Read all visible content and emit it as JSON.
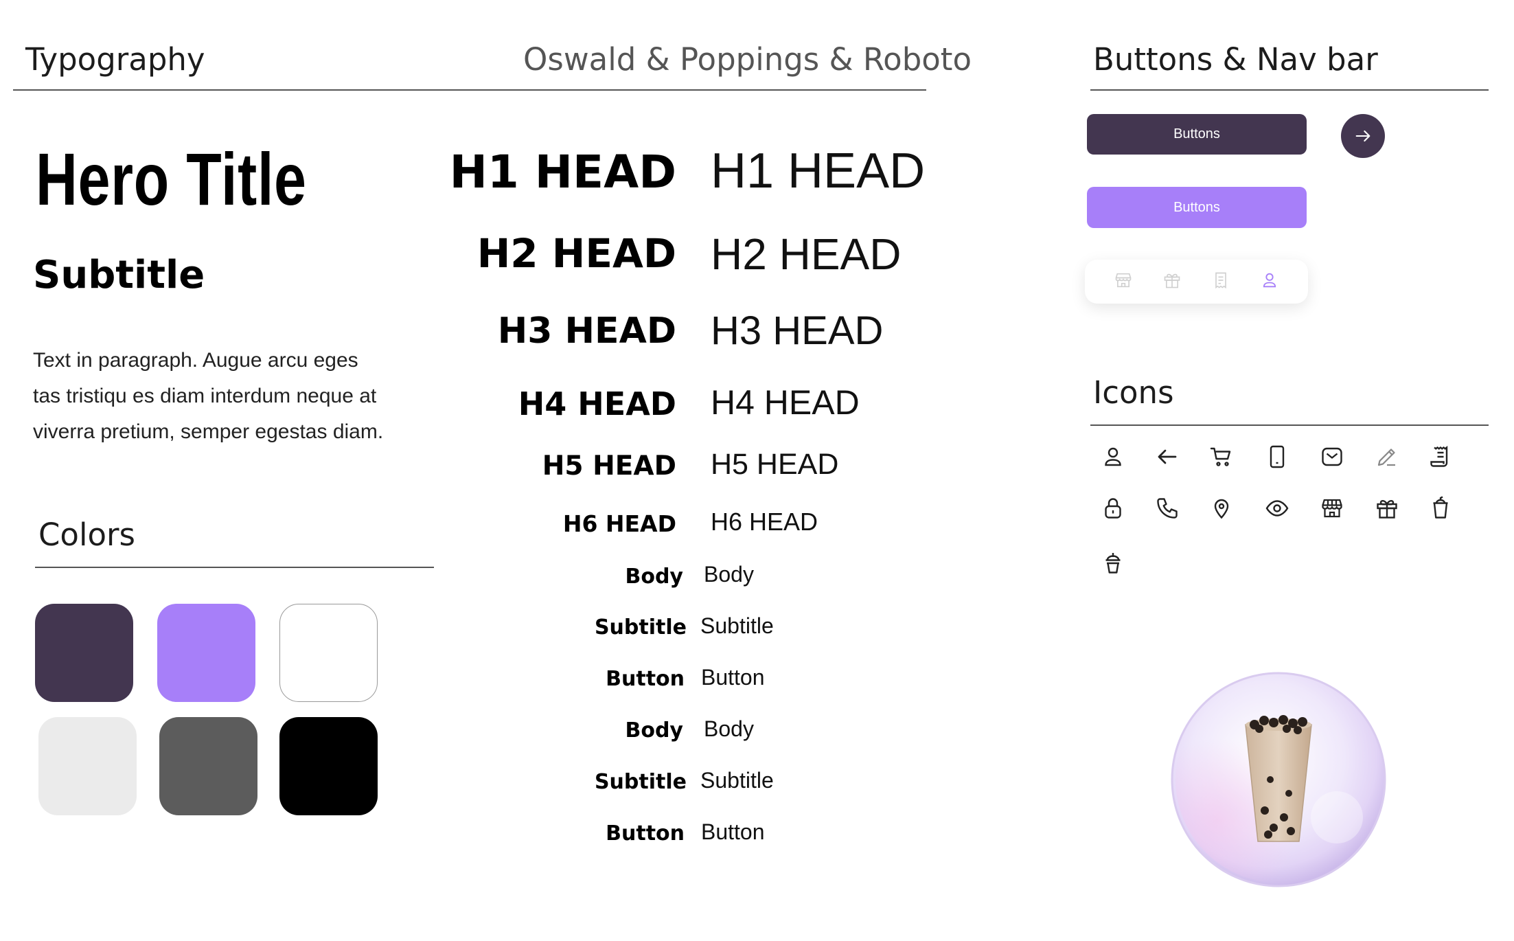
{
  "typography": {
    "section_title": "Typography",
    "fonts_caption": "Oswald & Poppings & Roboto",
    "hero_title": "Hero Title",
    "subtitle": "Subtitle",
    "paragraph_lines": [
      "Text in paragraph. Augue arcu eges",
      "tas tristiqu es diam interdum neque at",
      "viverra pretium, semper egestas diam."
    ],
    "headings": [
      {
        "bold": "H1 HEAD",
        "regular": "H1 HEAD"
      },
      {
        "bold": "H2 HEAD",
        "regular": "H2 HEAD"
      },
      {
        "bold": "H3 HEAD",
        "regular": "H3 HEAD"
      },
      {
        "bold": "H4 HEAD",
        "regular": "H4 HEAD"
      },
      {
        "bold": "H5 HEAD",
        "regular": "H5 HEAD"
      },
      {
        "bold": "H6 HEAD",
        "regular": "H6 HEAD"
      }
    ],
    "text_styles": [
      {
        "bold": "Body",
        "regular": "Body"
      },
      {
        "bold": "Subtitle",
        "regular": "Subtitle"
      },
      {
        "bold": "Button",
        "regular": "Button"
      },
      {
        "bold": "Body",
        "regular": "Body"
      },
      {
        "bold": "Subtitle",
        "regular": "Subtitle"
      },
      {
        "bold": "Button",
        "regular": "Button"
      }
    ]
  },
  "colors": {
    "section_title": "Colors",
    "swatches": [
      "#433650",
      "#a77ff9",
      "#ffffff",
      "#ebebeb",
      "#5c5c5c",
      "#000000"
    ]
  },
  "buttons": {
    "section_title": "Buttons & Nav bar",
    "primary_label": "Buttons",
    "secondary_label": "Buttons",
    "primary_color": "#433650",
    "secondary_color": "#a77ff9",
    "arrow_icon": "arrow-right-icon",
    "nav_icons": [
      "store-icon",
      "gift-icon",
      "receipt-icon",
      "user-icon"
    ],
    "nav_active": "user-icon"
  },
  "icons": {
    "section_title": "Icons",
    "items": [
      "user-icon",
      "arrow-left-icon",
      "cart-icon",
      "phone-device-icon",
      "mail-icon",
      "pencil-icon",
      "receipt-icon",
      "lock-icon",
      "phone-call-icon",
      "location-pin-icon",
      "eye-icon",
      "store-icon",
      "gift-icon",
      "cup-icon",
      "bubble-tea-icon"
    ]
  }
}
